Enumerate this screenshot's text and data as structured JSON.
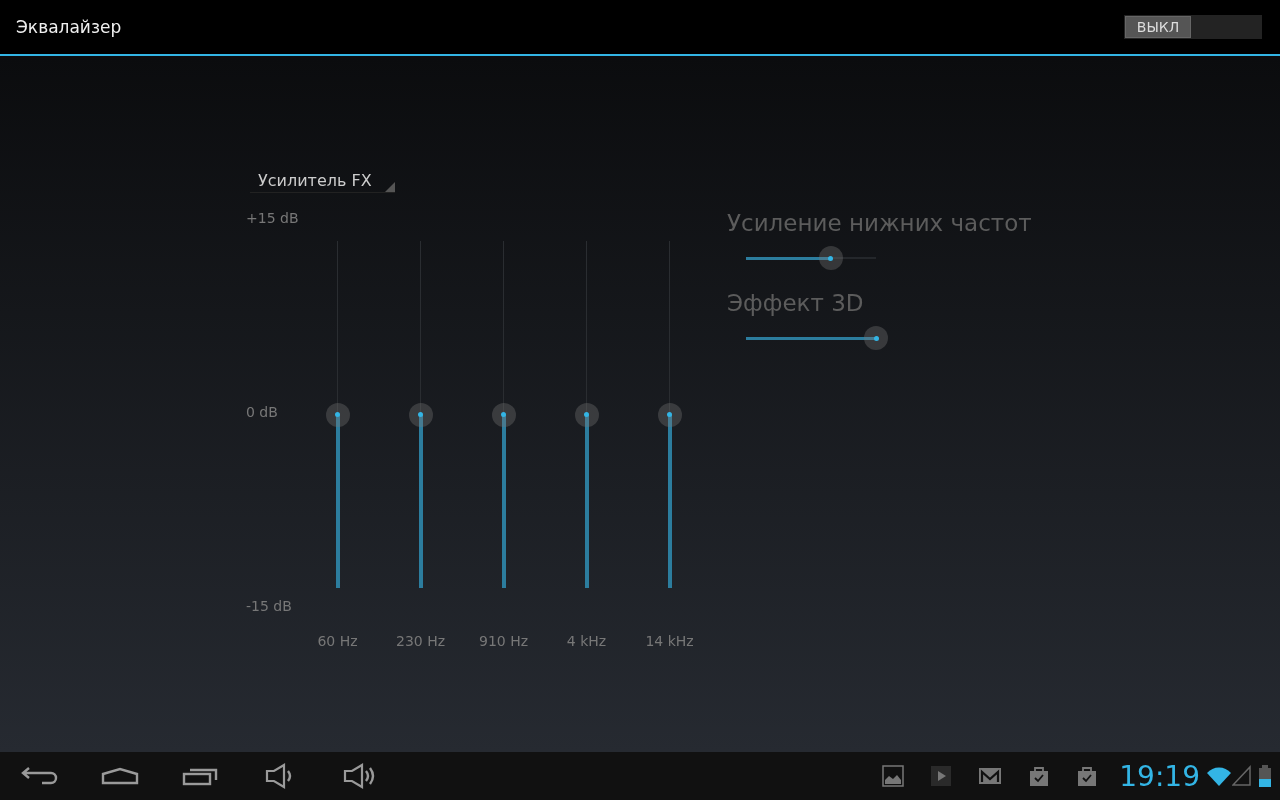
{
  "action_bar": {
    "title": "Эквалайзер",
    "switch": {
      "label": "ВЫКЛ",
      "on": false
    }
  },
  "preset": {
    "label": "Усилитель FX"
  },
  "equalizer": {
    "scale": [
      "+15 dB",
      "0 dB",
      "-15 dB"
    ],
    "bands": [
      {
        "label": "60 Hz",
        "level": 0.5
      },
      {
        "label": "230 Hz",
        "level": 0.5
      },
      {
        "label": "910 Hz",
        "level": 0.5
      },
      {
        "label": "4 kHz",
        "level": 0.5
      },
      {
        "label": "14 kHz",
        "level": 0.5
      }
    ]
  },
  "effects": [
    {
      "label": "Усиление нижних частот",
      "level": 0.65
    },
    {
      "label": "Эффект 3D",
      "level": 1
    }
  ],
  "status_bar": {
    "time": "19:19"
  }
}
